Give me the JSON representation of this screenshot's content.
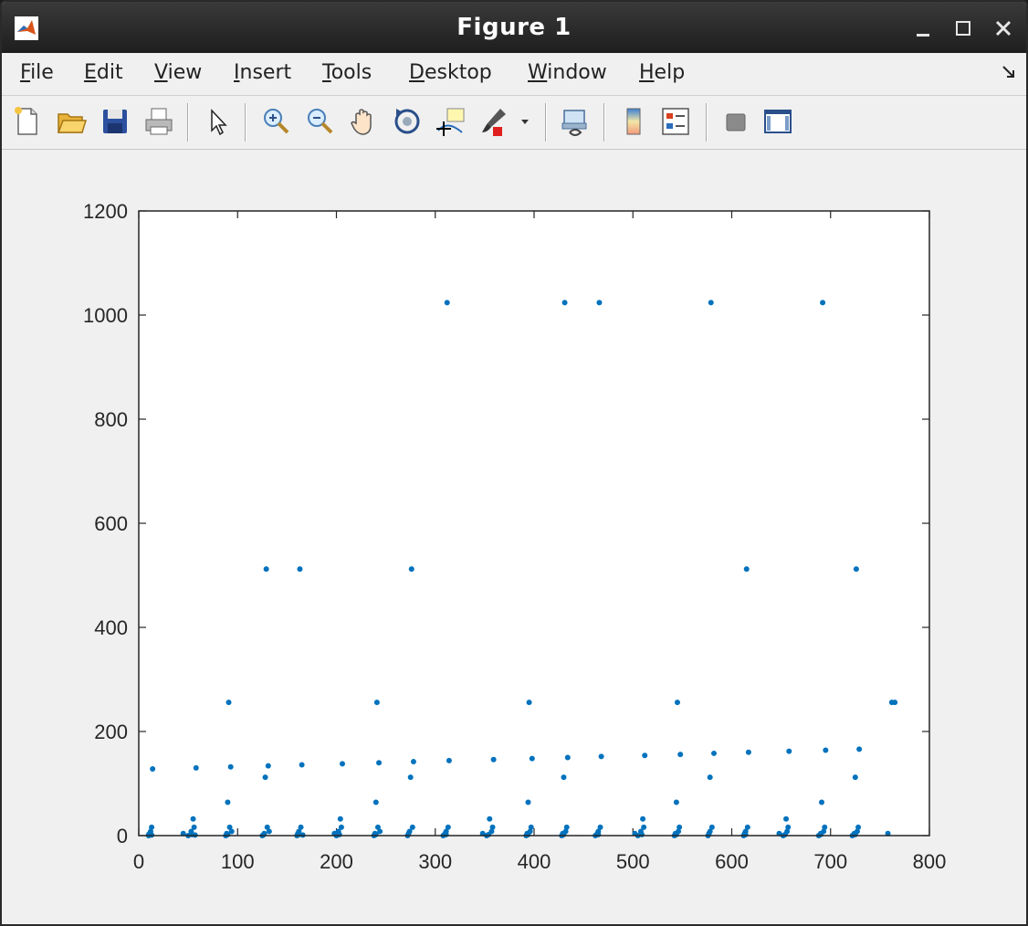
{
  "window": {
    "title": "Figure 1"
  },
  "menu": [
    {
      "prefix": "",
      "accel": "F",
      "rest": "ile"
    },
    {
      "prefix": "",
      "accel": "E",
      "rest": "dit"
    },
    {
      "prefix": "",
      "accel": "V",
      "rest": "iew"
    },
    {
      "prefix": "",
      "accel": "I",
      "rest": "nsert"
    },
    {
      "prefix": "",
      "accel": "T",
      "rest": "ools"
    },
    {
      "prefix": "",
      "accel": "D",
      "rest": "esktop"
    },
    {
      "prefix": "",
      "accel": "W",
      "rest": "indow"
    },
    {
      "prefix": "",
      "accel": "H",
      "rest": "elp"
    }
  ],
  "toolbar": [
    "new-figure-icon",
    "open-file-icon",
    "save-icon",
    "print-icon",
    "edit-plot-arrow-icon",
    "zoom-in-icon",
    "zoom-out-icon",
    "pan-hand-icon",
    "rotate-3d-icon",
    "data-cursor-icon",
    "brush-icon",
    "brush-dropdown-icon",
    "link-plot-icon",
    "colorbar-icon",
    "legend-icon",
    "hide-plot-tools-icon",
    "show-plot-tools-icon"
  ],
  "chart_data": {
    "type": "scatter",
    "title": "",
    "xlabel": "",
    "ylabel": "",
    "xlim": [
      0,
      800
    ],
    "ylim": [
      0,
      1200
    ],
    "xticks": [
      0,
      100,
      200,
      300,
      400,
      500,
      600,
      700,
      800
    ],
    "yticks": [
      0,
      200,
      400,
      600,
      800,
      1000,
      1200
    ],
    "marker_color": "#0072BD",
    "grid": false,
    "series": [
      {
        "points": [
          [
            10,
            0
          ],
          [
            11,
            4
          ],
          [
            12,
            8
          ],
          [
            13,
            16
          ],
          [
            14,
            128
          ],
          [
            10,
            2
          ],
          [
            13,
            1
          ],
          [
            45,
            4
          ],
          [
            50,
            0
          ],
          [
            53,
            8
          ],
          [
            55,
            32
          ],
          [
            56,
            16
          ],
          [
            58,
            130
          ],
          [
            54,
            2
          ],
          [
            57,
            1
          ],
          [
            88,
            0
          ],
          [
            89,
            4
          ],
          [
            90,
            64
          ],
          [
            91,
            256
          ],
          [
            92,
            16
          ],
          [
            93,
            132
          ],
          [
            94,
            8
          ],
          [
            90,
            2
          ],
          [
            125,
            0
          ],
          [
            127,
            4
          ],
          [
            128,
            112
          ],
          [
            129,
            512
          ],
          [
            130,
            16
          ],
          [
            131,
            134
          ],
          [
            132,
            8
          ],
          [
            126,
            1
          ],
          [
            160,
            0
          ],
          [
            161,
            4
          ],
          [
            162,
            8
          ],
          [
            163,
            512
          ],
          [
            164,
            16
          ],
          [
            165,
            136
          ],
          [
            162,
            2
          ],
          [
            166,
            1
          ],
          [
            198,
            4
          ],
          [
            200,
            0
          ],
          [
            202,
            8
          ],
          [
            204,
            32
          ],
          [
            205,
            16
          ],
          [
            206,
            138
          ],
          [
            203,
            2
          ],
          [
            238,
            0
          ],
          [
            239,
            4
          ],
          [
            240,
            64
          ],
          [
            241,
            256
          ],
          [
            242,
            16
          ],
          [
            243,
            140
          ],
          [
            244,
            8
          ],
          [
            240,
            2
          ],
          [
            272,
            0
          ],
          [
            274,
            8
          ],
          [
            275,
            112
          ],
          [
            276,
            512
          ],
          [
            277,
            16
          ],
          [
            278,
            142
          ],
          [
            273,
            4
          ],
          [
            308,
            0
          ],
          [
            310,
            4
          ],
          [
            311,
            8
          ],
          [
            312,
            1024
          ],
          [
            313,
            16
          ],
          [
            314,
            144
          ],
          [
            311,
            2
          ],
          [
            309,
            1
          ],
          [
            348,
            4
          ],
          [
            352,
            0
          ],
          [
            355,
            32
          ],
          [
            357,
            8
          ],
          [
            358,
            16
          ],
          [
            359,
            146
          ],
          [
            354,
            2
          ],
          [
            392,
            0
          ],
          [
            393,
            4
          ],
          [
            394,
            64
          ],
          [
            395,
            256
          ],
          [
            396,
            8
          ],
          [
            397,
            16
          ],
          [
            398,
            148
          ],
          [
            394,
            2
          ],
          [
            428,
            0
          ],
          [
            429,
            4
          ],
          [
            430,
            112
          ],
          [
            431,
            1024
          ],
          [
            432,
            8
          ],
          [
            433,
            16
          ],
          [
            434,
            150
          ],
          [
            430,
            2
          ],
          [
            462,
            0
          ],
          [
            464,
            4
          ],
          [
            465,
            8
          ],
          [
            466,
            1024
          ],
          [
            467,
            16
          ],
          [
            468,
            152
          ],
          [
            465,
            2
          ],
          [
            502,
            4
          ],
          [
            505,
            0
          ],
          [
            508,
            8
          ],
          [
            510,
            32
          ],
          [
            511,
            16
          ],
          [
            512,
            154
          ],
          [
            509,
            2
          ],
          [
            542,
            0
          ],
          [
            543,
            4
          ],
          [
            544,
            64
          ],
          [
            545,
            256
          ],
          [
            546,
            8
          ],
          [
            547,
            16
          ],
          [
            548,
            156
          ],
          [
            544,
            2
          ],
          [
            576,
            0
          ],
          [
            577,
            4
          ],
          [
            578,
            112
          ],
          [
            579,
            1024
          ],
          [
            580,
            16
          ],
          [
            582,
            158
          ],
          [
            578,
            8
          ],
          [
            612,
            0
          ],
          [
            613,
            4
          ],
          [
            614,
            8
          ],
          [
            615,
            512
          ],
          [
            616,
            16
          ],
          [
            617,
            160
          ],
          [
            614,
            2
          ],
          [
            648,
            4
          ],
          [
            652,
            0
          ],
          [
            655,
            32
          ],
          [
            656,
            8
          ],
          [
            657,
            16
          ],
          [
            658,
            162
          ],
          [
            654,
            2
          ],
          [
            688,
            0
          ],
          [
            690,
            4
          ],
          [
            691,
            64
          ],
          [
            692,
            1024
          ],
          [
            693,
            8
          ],
          [
            694,
            16
          ],
          [
            695,
            164
          ],
          [
            690,
            2
          ],
          [
            722,
            0
          ],
          [
            724,
            4
          ],
          [
            725,
            112
          ],
          [
            726,
            512
          ],
          [
            727,
            8
          ],
          [
            728,
            16
          ],
          [
            729,
            166
          ],
          [
            725,
            2
          ],
          [
            758,
            4
          ],
          [
            762,
            256
          ],
          [
            765,
            256
          ]
        ]
      }
    ]
  }
}
